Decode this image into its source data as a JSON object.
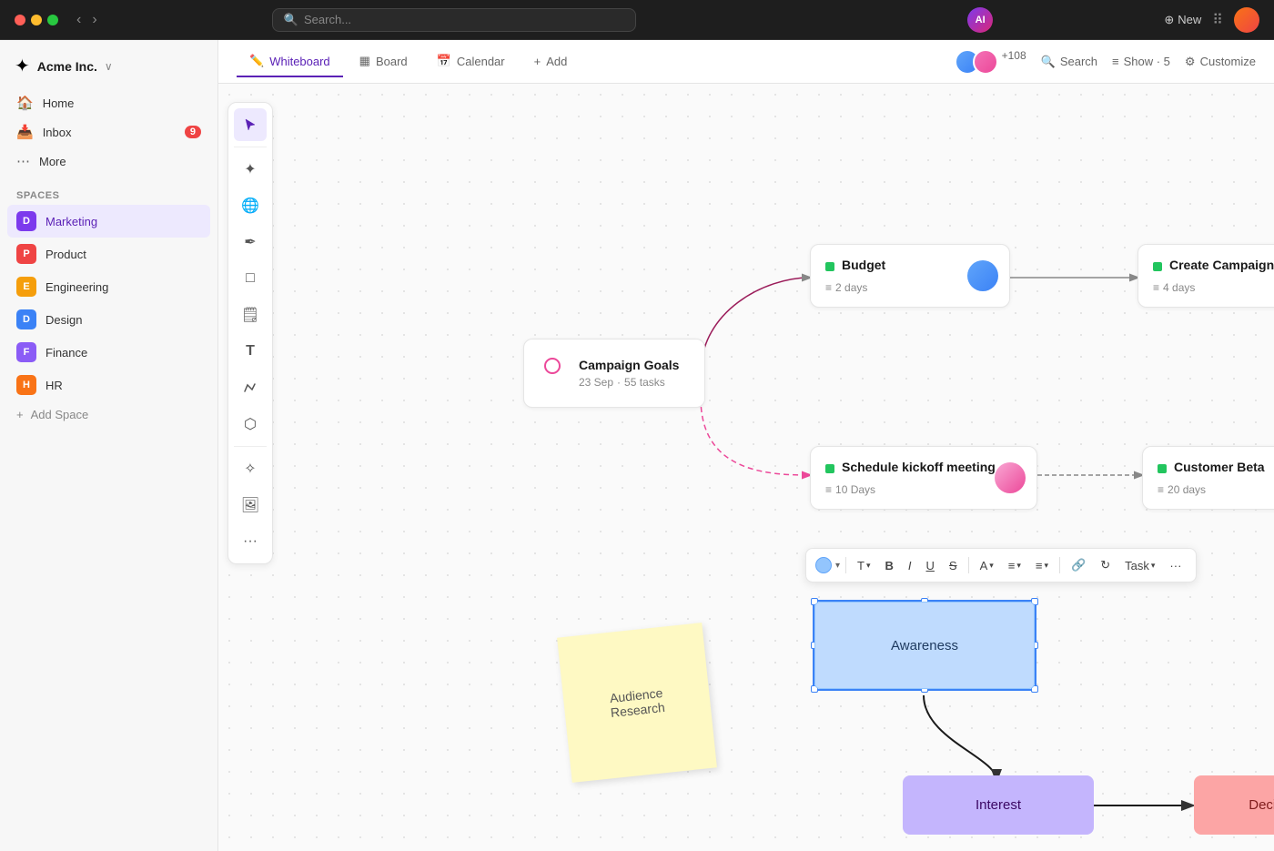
{
  "topbar": {
    "search_placeholder": "Search...",
    "ai_label": "AI",
    "new_label": "New"
  },
  "sidebar": {
    "app_name": "Acme Inc.",
    "nav": [
      {
        "label": "Home",
        "icon": "🏠"
      },
      {
        "label": "Inbox",
        "icon": "📥",
        "badge": "9"
      },
      {
        "label": "More",
        "icon": "⋯"
      }
    ],
    "spaces_header": "Spaces",
    "spaces": [
      {
        "label": "Marketing",
        "initial": "D",
        "color": "#7c3aed",
        "active": true
      },
      {
        "label": "Product",
        "initial": "P",
        "color": "#ef4444"
      },
      {
        "label": "Engineering",
        "initial": "E",
        "color": "#f59e0b"
      },
      {
        "label": "Design",
        "initial": "D",
        "color": "#3b82f6"
      },
      {
        "label": "Finance",
        "initial": "F",
        "color": "#8b5cf6"
      },
      {
        "label": "HR",
        "initial": "H",
        "color": "#f97316"
      }
    ],
    "add_space": "Add Space"
  },
  "tabs": [
    {
      "label": "Whiteboard",
      "icon": "✏️",
      "active": true
    },
    {
      "label": "Board",
      "icon": "▦"
    },
    {
      "label": "Calendar",
      "icon": "📅"
    },
    {
      "label": "Add",
      "icon": "+"
    }
  ],
  "tabs_right": {
    "search": "Search",
    "show": "Show · 5",
    "customize": "Customize",
    "avatar_count": "+108"
  },
  "whiteboard": {
    "cards": {
      "budget": {
        "title": "Budget",
        "sub": "2 days"
      },
      "create_campaign": {
        "title": "Create Campaign",
        "sub": "4 days"
      },
      "campaign_goals": {
        "title": "Campaign Goals",
        "date": "23 Sep",
        "tasks": "55 tasks"
      },
      "schedule_kickoff": {
        "title": "Schedule kickoff meeting",
        "sub": "10 Days"
      },
      "customer_beta": {
        "title": "Customer Beta",
        "sub": "20 days"
      }
    },
    "shapes": {
      "awareness": "Awareness",
      "interest": "Interest",
      "decision": "Decision",
      "sticky": "Audience\nResearch"
    },
    "toolbar": {
      "color_label": "Color",
      "text_label": "T",
      "bold": "B",
      "italic": "I",
      "underline": "U",
      "strikethrough": "S",
      "font": "A",
      "align": "≡",
      "list": "≡",
      "link": "🔗",
      "task": "Task",
      "more": "···"
    }
  }
}
